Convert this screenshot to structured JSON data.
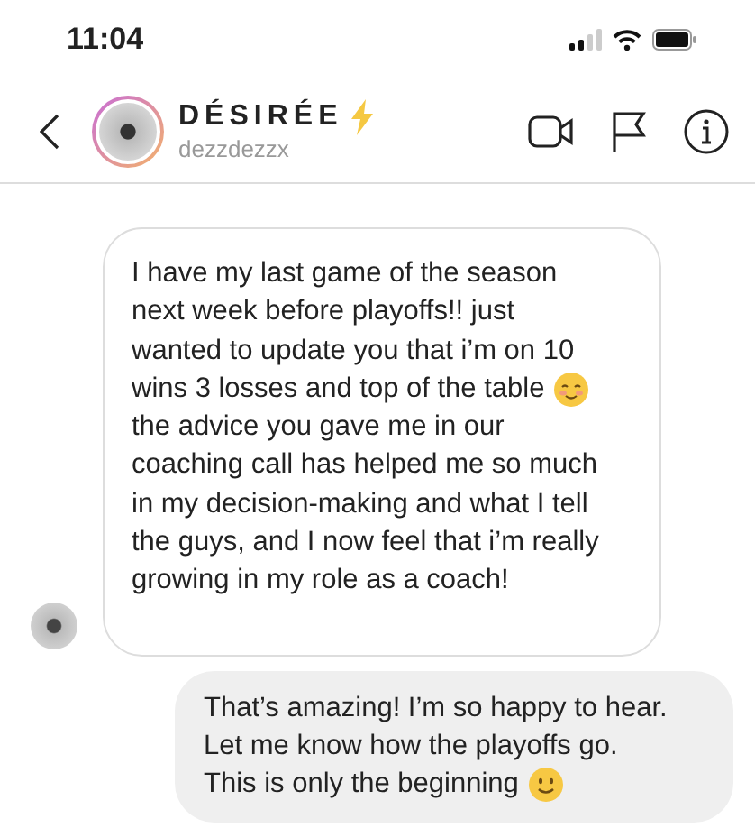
{
  "status_bar": {
    "time": "11:04"
  },
  "header": {
    "name": "DÉSIRÉE",
    "username": "dezzdezzx"
  },
  "messages": [
    {
      "kind": "incoming",
      "parts": [
        {
          "kind": "plain",
          "text": "I have my last game of the season\nnext week before playoffs!! just\nwanted to update you that i’m on 10"
        },
        {
          "kind": "blush",
          "text": "wins 3 losses and top of the table"
        },
        {
          "kind": "plain",
          "text": "the advice you gave me in our\ncoaching call has helped me so much\nin my decision-making and what I tell\nthe guys, and I now feel that i’m really\ngrowing in my role as a coach!"
        }
      ]
    },
    {
      "kind": "outgoing",
      "parts": [
        {
          "kind": "plain",
          "text": "That’s amazing! I’m so happy to hear.\nLet me know how the playoffs go."
        },
        {
          "kind": "smile",
          "text": "This is only the beginning"
        }
      ]
    }
  ]
}
